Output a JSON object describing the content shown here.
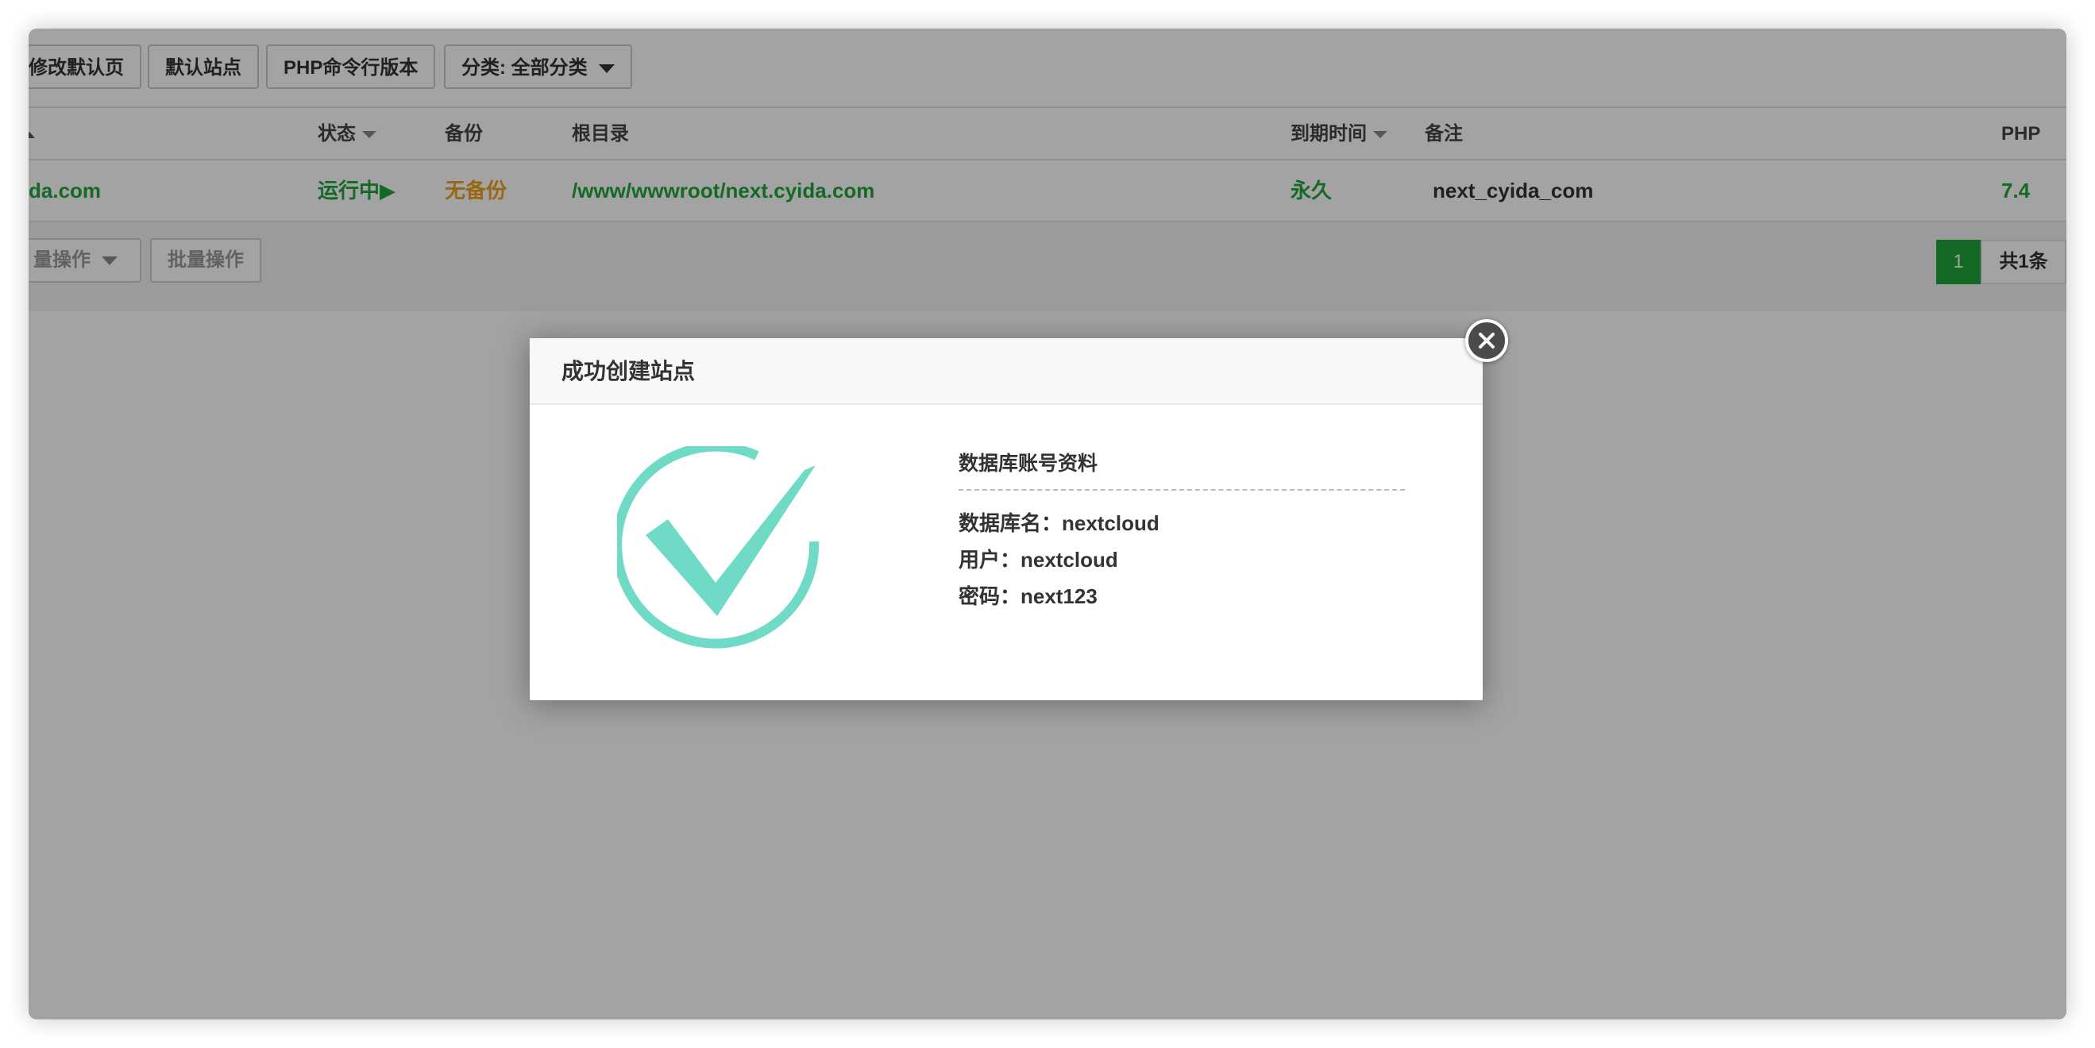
{
  "toolbar": {
    "set_default_page": "修改默认页",
    "default_site": "默认站点",
    "php_cli_version": "PHP命令行版本",
    "category_label": "分类: 全部分类"
  },
  "table": {
    "headers": {
      "status": "状态",
      "backup": "备份",
      "root_dir": "根目录",
      "expire": "到期时间",
      "remark": "备注",
      "php": "PHP"
    },
    "rows": [
      {
        "site": "da.com",
        "status": "运行中▶",
        "backup": "无备份",
        "root_dir": "/www/wwwroot/next.cyida.com",
        "expire": "永久",
        "remark": "next_cyida_com",
        "php": "7.4"
      }
    ]
  },
  "footer": {
    "batch_select": "量操作",
    "batch_action": "批量操作",
    "page_current": "1",
    "page_total": "共1条"
  },
  "modal": {
    "title": "成功创建站点",
    "db_heading": "数据库账号资料",
    "db_name": "数据库名：nextcloud",
    "db_user": "用户：nextcloud",
    "db_password": "密码：next123"
  },
  "colors": {
    "accent_green": "#20a53a",
    "warning_orange": "#f0a020",
    "check_teal": "#6fdac5"
  },
  "icons": {
    "success": "check-circle-icon",
    "close": "close-icon"
  }
}
